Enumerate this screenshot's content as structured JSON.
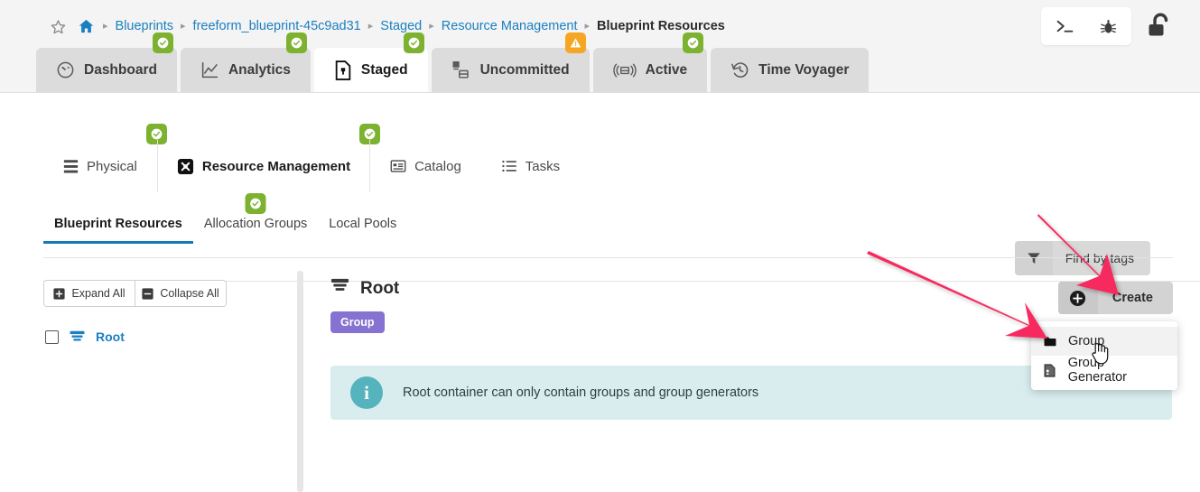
{
  "breadcrumb": {
    "star_icon": "star-outline-icon",
    "home_icon": "home-icon",
    "separator": "▸",
    "items": [
      {
        "label": "Blueprints",
        "current": false
      },
      {
        "label": "freeform_blueprint-45c9ad31",
        "current": false
      },
      {
        "label": "Staged",
        "current": false
      },
      {
        "label": "Resource Management",
        "current": false
      },
      {
        "label": "Blueprint Resources",
        "current": true
      }
    ]
  },
  "top_tools": [
    {
      "name": "terminal-icon",
      "glyph": ">_"
    },
    {
      "name": "bug-icon",
      "glyph": "bug"
    },
    {
      "name": "unlock-icon",
      "glyph": "unlocked-padlock"
    }
  ],
  "primary_tabs": [
    {
      "label": "Dashboard",
      "icon": "gauge-icon",
      "active": false,
      "badge": "ok"
    },
    {
      "label": "Analytics",
      "icon": "line-chart-icon",
      "active": false,
      "badge": "ok"
    },
    {
      "label": "Staged",
      "icon": "document-icon",
      "active": true,
      "badge": "ok"
    },
    {
      "label": "Uncommitted",
      "icon": "boxes-icon",
      "active": false,
      "badge": "warn"
    },
    {
      "label": "Active",
      "icon": "broadcast-icon",
      "active": false,
      "badge": "ok"
    },
    {
      "label": "Time Voyager",
      "icon": "history-icon",
      "active": false,
      "badge": null
    }
  ],
  "secondary_tabs": [
    {
      "label": "Physical",
      "icon": "racks-icon",
      "active": false,
      "badge": true
    },
    {
      "label": "Resource Management",
      "icon": "resource-icon",
      "active": true,
      "badge": true
    },
    {
      "label": "Catalog",
      "icon": "catalog-icon",
      "active": false,
      "badge": false
    },
    {
      "label": "Tasks",
      "icon": "list-icon",
      "active": false,
      "badge": false
    }
  ],
  "find_by_tags": {
    "label": "Find by tags",
    "icon": "filter-icon"
  },
  "tertiary_tabs": [
    {
      "label": "Blueprint Resources",
      "active": true,
      "badge": false
    },
    {
      "label": "Allocation Groups",
      "active": false,
      "badge": true
    },
    {
      "label": "Local Pools",
      "active": false,
      "badge": false
    }
  ],
  "tree_panel": {
    "expand_all": "Expand All",
    "collapse_all": "Collapse All",
    "root_label": "Root"
  },
  "detail": {
    "title": "Root",
    "type_chip": "Group",
    "info_message": "Root container can only contain groups and group generators",
    "info_glyph": "i"
  },
  "create": {
    "label": "Create",
    "icon": "plus-circle-icon",
    "menu": [
      {
        "label": "Group",
        "icon": "folder-icon",
        "hovered": true
      },
      {
        "label": "Group Generator",
        "icon": "file-gear-icon",
        "hovered": false
      }
    ]
  },
  "colors": {
    "accent_blue": "#1879b5",
    "link_blue": "#1a7fc1",
    "badge_green": "#7cb230",
    "badge_orange": "#f5a623",
    "group_purple": "#8572d1",
    "info_bg": "#d9edef",
    "info_circle": "#55b3bd",
    "arrow_pink": "#f7295e",
    "header_bg": "#f4f4f4",
    "tab_inactive": "#dcdcdc"
  }
}
